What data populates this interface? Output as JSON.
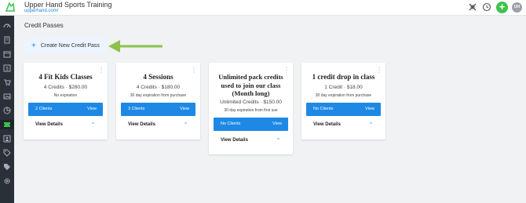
{
  "header": {
    "title": "Upper Hand Sports Training",
    "url": "upperhand.com/",
    "avatar_initials": "UH",
    "add_symbol": "+",
    "icons": [
      "crosshair-icon",
      "clock-icon",
      "add-icon",
      "avatar"
    ]
  },
  "sidebar": {
    "items": [
      {
        "icon": "gauge-icon"
      },
      {
        "icon": "book-icon"
      },
      {
        "icon": "calendar-icon"
      },
      {
        "icon": "dollar-icon"
      },
      {
        "icon": "cart-icon"
      },
      {
        "icon": "image-icon"
      },
      {
        "icon": "chart-icon"
      },
      {
        "icon": "ticket-icon",
        "active": true
      },
      {
        "icon": "contacts-icon"
      },
      {
        "icon": "tag-icon"
      },
      {
        "icon": "tags-icon"
      },
      {
        "icon": "settings-icon"
      }
    ]
  },
  "page": {
    "title": "Credit Passes",
    "create_button": "Create New Credit Pass",
    "create_plus": "+"
  },
  "cards": [
    {
      "title": "4 Fit Kids Classes",
      "credits": "4 Credits · $280.00",
      "expiry": "No expiration",
      "clients": "2 Clients",
      "view": "View",
      "details": "View Details",
      "chevron": "^"
    },
    {
      "title": "4 Sessions",
      "credits": "4 Credits · $180.00",
      "expiry": "30 day expiration from purchase",
      "clients": "3 Clients",
      "view": "View",
      "details": "View Details",
      "chevron": "^"
    },
    {
      "title": "Unlimited pack credits used to join our class (Month long)",
      "credits": "Unlimited Credits · $150.00",
      "expiry": "30 day expiration from first use",
      "clients": "No Clients",
      "view": "View",
      "details": "View Details",
      "chevron": "^"
    },
    {
      "title": "1 credit drop in class",
      "credits": "1 Credit · $18.00",
      "expiry": "30 day expiration from purchase",
      "clients": "No Clients",
      "view": "View",
      "details": "View Details",
      "chevron": "^"
    }
  ],
  "colors": {
    "accent": "#1e88e5",
    "add_button": "#3cc24a",
    "sidebar": "#2a3038",
    "arrow": "#8bc34a"
  }
}
